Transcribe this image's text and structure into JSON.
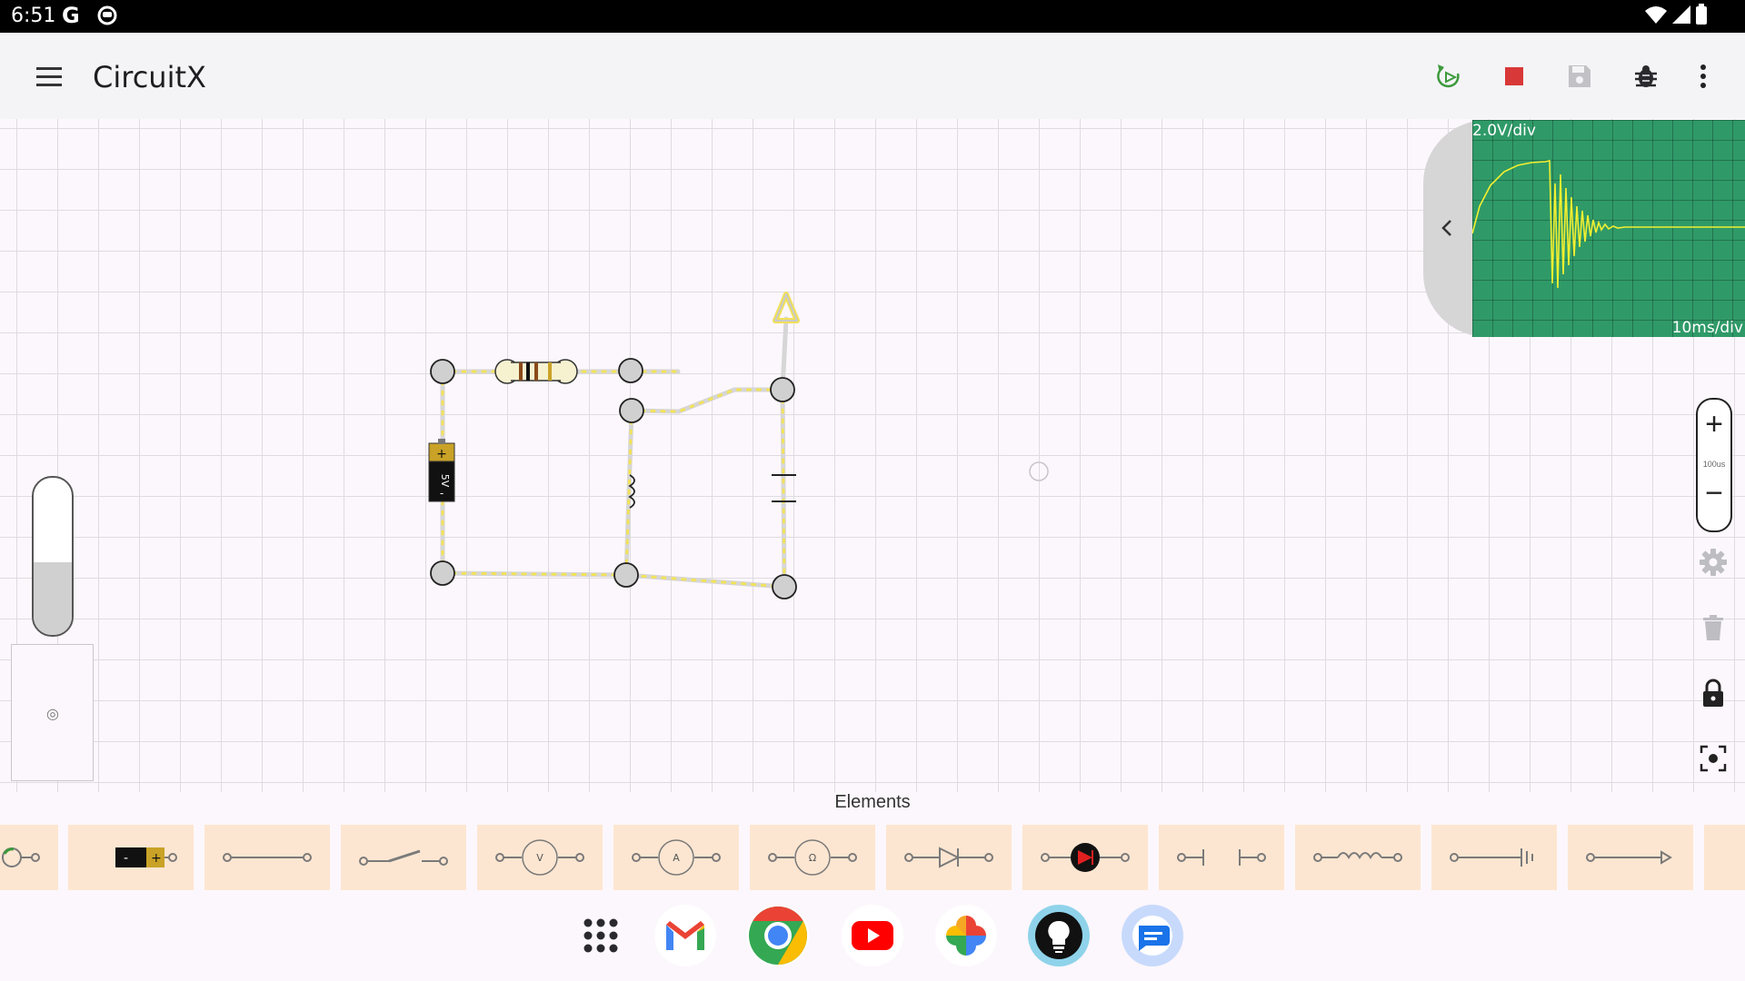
{
  "status_bar": {
    "time": "6:51",
    "g_label": "G"
  },
  "app_bar": {
    "title": "CircuitX"
  },
  "circuit": {
    "battery_label": "5V",
    "battery_plus": "+",
    "battery_minus": "-"
  },
  "scope": {
    "v_div": "2.0V/div",
    "t_div": "10ms/div"
  },
  "zoom": {
    "plus": "+",
    "minus": "−",
    "level": "100us"
  },
  "elements": {
    "title": "Elements",
    "items": [
      "cell",
      "battery",
      "wire",
      "switch",
      "voltmeter",
      "ammeter",
      "ohmmeter",
      "diode",
      "led",
      "capacitor",
      "inductor",
      "ground",
      "probe",
      "more"
    ],
    "battery_minus": "-",
    "battery_plus": "+",
    "voltmeter_letter": "V",
    "ammeter_letter": "A",
    "ohmmeter_letter": "Ω"
  },
  "dock": {
    "apps": [
      "app-drawer",
      "gmail",
      "chrome",
      "youtube",
      "photos",
      "tips",
      "messages"
    ]
  }
}
